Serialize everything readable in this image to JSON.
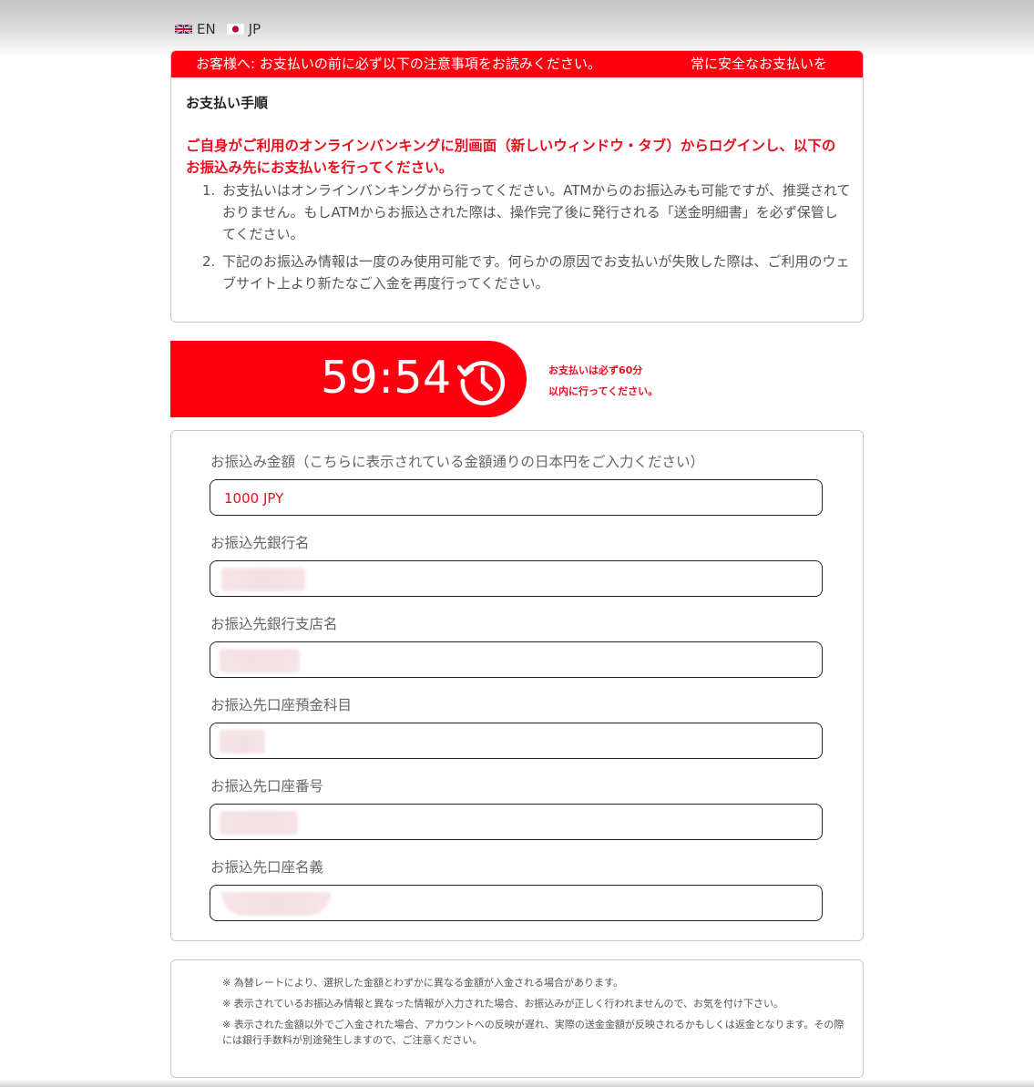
{
  "lang": [
    {
      "code": "EN",
      "flag": "uk-flag-icon"
    },
    {
      "code": "JP",
      "flag": "japan-flag-icon"
    }
  ],
  "notice": {
    "marquee_1": "お客様へ: お支払いの前に必ず以下の注意事項をお読みください。",
    "marquee_2": "常に安全なお支払いを",
    "title": "お支払い手順",
    "red_instruction": "ご自身がご利用のオンラインバンキングに別画面（新しいウィンドウ・タブ）からログインし、以下のお振込み先にお支払いを行ってください。",
    "items": [
      {
        "num": "1.",
        "text": "お支払いはオンラインバンキングから行ってください。ATMからのお振込みも可能ですが、推奨されておりません。もしATMからお振込された際は、操作完了後に発行される「送金明細書」を必ず保管してください。"
      },
      {
        "num": "2.",
        "text": "下記のお振込み情報は一度のみ使用可能です。何らかの原因でお支払いが失敗した際は、ご利用のウェブサイト上より新たなご入金を再度行ってください。"
      }
    ]
  },
  "timer": {
    "remaining": "59:54",
    "note_line1": "お支払いは必ず60分",
    "note_line2": "以内に行ってください。"
  },
  "form": {
    "amount_label": "お振込み金額（こちらに表示されている金額通りの日本円をご入力ください）",
    "amount_value": "1000 JPY",
    "bank_label": "お振込先銀行名",
    "branch_label": "お振込先銀行支店名",
    "account_type_label": "お振込先口座預金科目",
    "account_number_label": "お振込先口座番号",
    "account_name_label": "お振込先口座名義"
  },
  "footer": {
    "notes": [
      "※ 為替レートにより、選択した金額とわずかに異なる金額が入金される場合があります。",
      "※ 表示されているお振込み情報と異なった情報が入力された場合、お振込みが正しく行われませんので、お気を付け下さい。",
      "※ 表示された金額以外でご入金された場合、アカウントへの反映が遅れ、実際の送金金額が反映されるかもしくは返金となります。その際には銀行手数料が別途発生しますので、ご注意ください。"
    ]
  },
  "colors": {
    "accent_red": "#ff0010",
    "text_red": "#e8101e"
  }
}
